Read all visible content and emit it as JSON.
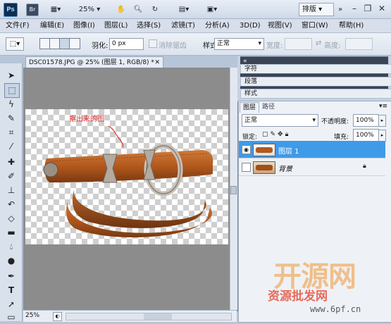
{
  "appbar": {
    "logo": "Ps",
    "bridge": "Br",
    "zoom": "25%",
    "workspace": "排版"
  },
  "menu": [
    "文件(F)",
    "编辑(E)",
    "图像(I)",
    "图层(L)",
    "选择(S)",
    "滤镜(T)",
    "分析(A)",
    "3D(D)",
    "视图(V)",
    "窗口(W)",
    "帮助(H)"
  ],
  "options": {
    "feather_label": "羽化:",
    "feather_value": "0 px",
    "antialias_label": "消除锯齿",
    "style_label": "样式:",
    "style_value": "正常",
    "width_label": "宽度:",
    "height_label": "高度:"
  },
  "document": {
    "tab_title": "DSC01578.JPG @ 25% (图层 1, RGB/8) *",
    "zoom": "25%",
    "annotation": "抠出来的图"
  },
  "panels": {
    "collapsed": [
      "字符",
      "段落",
      "样式"
    ],
    "layers_tabs": [
      "图层",
      "路径"
    ],
    "blend_mode": "正常",
    "opacity_label": "不透明度:",
    "opacity_value": "100%",
    "lock_label": "锁定:",
    "fill_label": "填充:",
    "fill_value": "100%",
    "layers": [
      {
        "name": "图层 1",
        "selected": true
      },
      {
        "name": "背景",
        "selected": false
      }
    ]
  },
  "watermark": {
    "logo": "开源网",
    "tagline": "资源批发网",
    "url": "www.6pf.cn"
  },
  "colors": {
    "selected_layer": "#3f9ae8",
    "panel_bar": "#3a4454",
    "belt": "#b2581d"
  }
}
